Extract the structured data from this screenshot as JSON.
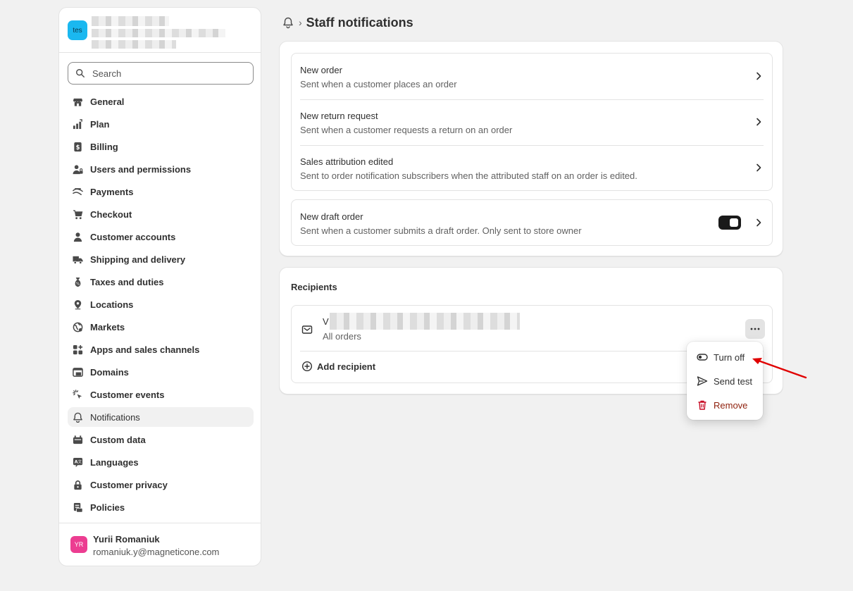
{
  "store": {
    "avatar_text": "tes"
  },
  "search": {
    "placeholder": "Search"
  },
  "nav": [
    {
      "label": "General",
      "icon": "store-icon"
    },
    {
      "label": "Plan",
      "icon": "plan-icon"
    },
    {
      "label": "Billing",
      "icon": "billing-icon"
    },
    {
      "label": "Users and permissions",
      "icon": "users-icon"
    },
    {
      "label": "Payments",
      "icon": "payments-icon"
    },
    {
      "label": "Checkout",
      "icon": "cart-icon"
    },
    {
      "label": "Customer accounts",
      "icon": "person-icon"
    },
    {
      "label": "Shipping and delivery",
      "icon": "truck-icon"
    },
    {
      "label": "Taxes and duties",
      "icon": "tax-icon"
    },
    {
      "label": "Locations",
      "icon": "location-icon"
    },
    {
      "label": "Markets",
      "icon": "globe-icon"
    },
    {
      "label": "Apps and sales channels",
      "icon": "apps-icon"
    },
    {
      "label": "Domains",
      "icon": "domains-icon"
    },
    {
      "label": "Customer events",
      "icon": "cursor-icon"
    },
    {
      "label": "Notifications",
      "icon": "bell-icon",
      "active": true
    },
    {
      "label": "Custom data",
      "icon": "custom-data-icon"
    },
    {
      "label": "Languages",
      "icon": "language-icon"
    },
    {
      "label": "Customer privacy",
      "icon": "lock-icon"
    },
    {
      "label": "Policies",
      "icon": "policies-icon"
    }
  ],
  "user": {
    "initials": "YR",
    "name": "Yurii Romaniuk",
    "email": "romaniuk.y@magneticone.com"
  },
  "page": {
    "title": "Staff notifications",
    "breadcrumb_icon": "bell-icon"
  },
  "notifications": [
    {
      "title": "New order",
      "subtitle": "Sent when a customer places an order"
    },
    {
      "title": "New return request",
      "subtitle": "Sent when a customer requests a return on an order"
    },
    {
      "title": "Sales attribution edited",
      "subtitle": "Sent to order notification subscribers when the attributed staff on an order is edited."
    }
  ],
  "draft_order": {
    "title": "New draft order",
    "subtitle": "Sent when a customer submits a draft order. Only sent to store owner",
    "enabled": true
  },
  "recipients": {
    "title": "Recipients",
    "recipient_initial": "V",
    "recipient_scope": "All orders",
    "add_label": "Add recipient"
  },
  "menu": {
    "turn_off": "Turn off",
    "send_test": "Send test",
    "remove": "Remove"
  },
  "colors": {
    "accent_store": "#1ab8f0",
    "avatar_user": "#ec3d91",
    "danger": "#8e1f0b",
    "annotation_arrow": "#e00000"
  }
}
